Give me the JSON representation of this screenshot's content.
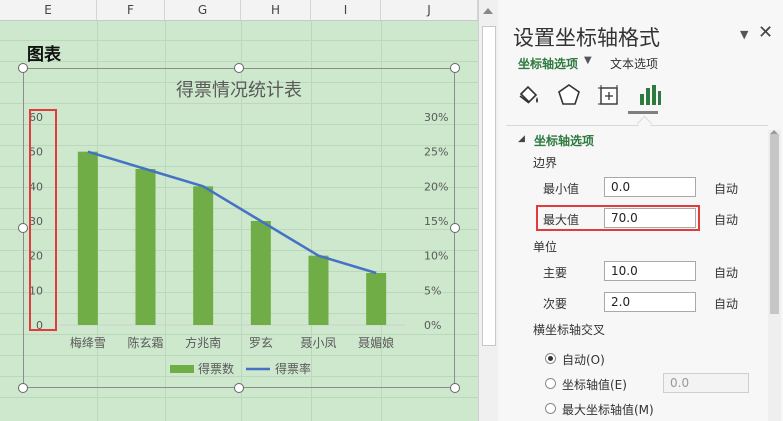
{
  "sheet": {
    "columns": [
      "E",
      "F",
      "G",
      "H",
      "I",
      "J"
    ],
    "title": "图表"
  },
  "chart_data": {
    "type": "bar",
    "title": "得票情况统计表",
    "categories": [
      "梅绛雪",
      "陈玄霜",
      "方兆南",
      "罗玄",
      "聂小凤",
      "聂媚娘"
    ],
    "series": [
      {
        "name": "得票数",
        "type": "bar",
        "axis": "left",
        "color": "#70ad47",
        "values": [
          50,
          45,
          40,
          30,
          20,
          15
        ]
      },
      {
        "name": "得票率",
        "type": "line",
        "axis": "right",
        "color": "#4472c4",
        "values": [
          0.25,
          0.225,
          0.2,
          0.15,
          0.1,
          0.075
        ]
      }
    ],
    "y_ticks": [
      "0",
      "10",
      "20",
      "30",
      "40",
      "50",
      "60"
    ],
    "y2_ticks": [
      "0%",
      "5%",
      "10%",
      "15%",
      "20%",
      "25%",
      "30%"
    ],
    "ylim": [
      0,
      60
    ],
    "y2lim": [
      0,
      0.3
    ],
    "legend_position": "bottom",
    "grid": false
  },
  "pane": {
    "title": "设置坐标轴格式",
    "collapse": "▼",
    "close": "✕",
    "tab_axis_options": "坐标轴选项",
    "tab_caret": "▼",
    "tab_text_options": "文本选项",
    "icons": [
      "fill-line-icon",
      "effects-icon",
      "size-properties-icon",
      "axis-options-icon"
    ],
    "section_caret": "◢",
    "section_header": "坐标轴选项",
    "bounds_label": "边界",
    "min_label": "最小值",
    "min_value": "0.0",
    "max_label": "最大值",
    "max_value": "70.0",
    "units_label": "单位",
    "major_label": "主要",
    "major_value": "10.0",
    "minor_label": "次要",
    "minor_value": "2.0",
    "auto_label": "自动",
    "cross_label": "横坐标轴交叉",
    "radio_auto": "自动(O)",
    "radio_axis_value": "坐标轴值(E)",
    "radio_axis_value_input": "0.0",
    "radio_max": "最大坐标轴值(M)",
    "accent_color": "#2f7a3f",
    "highlight_color": "#e03c3c"
  }
}
